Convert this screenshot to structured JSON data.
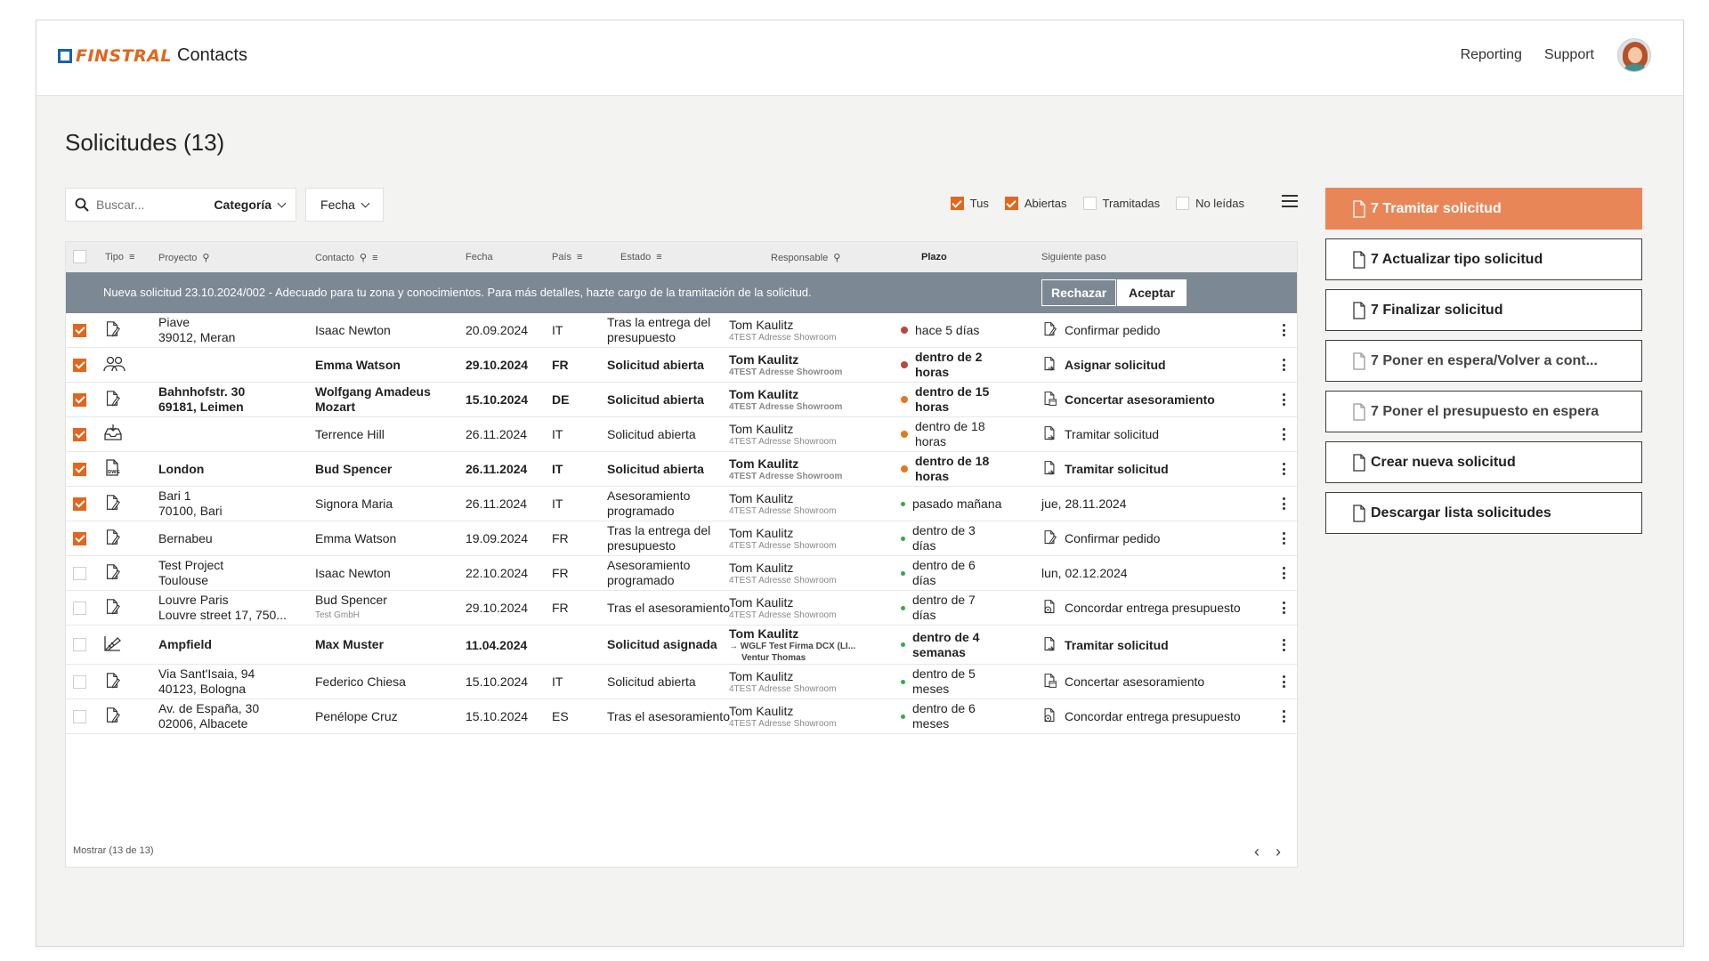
{
  "header": {
    "brand": "FINSTRAL",
    "app": "Contacts",
    "nav": [
      "Reporting",
      "Support"
    ]
  },
  "page": {
    "title": "Solicitudes (13)"
  },
  "toolbar": {
    "search_placeholder": "Buscar...",
    "category_label": "Categoría",
    "date_label": "Fecha",
    "filters": [
      {
        "label": "Tus",
        "checked": true
      },
      {
        "label": "Abiertas",
        "checked": true
      },
      {
        "label": "Tramitadas",
        "checked": false
      },
      {
        "label": "No leídas",
        "checked": false
      }
    ]
  },
  "table": {
    "columns": [
      "Tipo",
      "Proyecto",
      "Contacto",
      "Fecha",
      "País",
      "Estado",
      "Responsable",
      "Plazo",
      "Siguiente paso"
    ],
    "banner": {
      "text": "Nueva solicitud 23.10.2024/002 - Adecuado para tu zona y conocimientos. Para más detalles, hazte cargo de la tramitación de la solicitud.",
      "reject": "Rechazar",
      "accept": "Aceptar"
    },
    "rows": [
      {
        "checked": true,
        "icon": "document-pencil-icon",
        "bold": false,
        "project": [
          "Piave",
          "39012, Meran"
        ],
        "contact": [
          "Isaac Newton"
        ],
        "date": "20.09.2024",
        "country": "IT",
        "status": [
          "Tras la entrega del",
          "presupuesto"
        ],
        "resp": "Tom Kaulitz",
        "resp_sub": "4TEST Adresse Showroom",
        "deadline": [
          "hace 5 días"
        ],
        "dot": "#b8493c",
        "dot_small": false,
        "next": "Confirmar pedido",
        "next_icon": "document-pencil-icon"
      },
      {
        "checked": true,
        "icon": "people-icon",
        "bold": true,
        "project": [],
        "contact": [
          "Emma Watson"
        ],
        "date": "29.10.2024",
        "country": "FR",
        "status": [
          "Solicitud abierta"
        ],
        "resp": "Tom Kaulitz",
        "resp_sub": "4TEST Adresse Showroom",
        "deadline": [
          "dentro de 2",
          "horas"
        ],
        "dot": "#b8493c",
        "dot_small": false,
        "next": "Asignar solicitud",
        "next_icon": "document-arrow-icon"
      },
      {
        "checked": true,
        "icon": "document-pencil-icon",
        "bold": true,
        "project": [
          "Bahnhofstr. 30",
          "69181, Leimen"
        ],
        "contact": [
          "Wolfgang Amadeus",
          "Mozart"
        ],
        "date": "15.10.2024",
        "country": "DE",
        "status": [
          "Solicitud abierta"
        ],
        "resp": "Tom Kaulitz",
        "resp_sub": "4TEST Adresse Showroom",
        "deadline": [
          "dentro de 15",
          "horas"
        ],
        "dot": "#e07a1f",
        "dot_small": false,
        "next": "Concertar asesoramiento",
        "next_icon": "document-calendar-icon"
      },
      {
        "checked": true,
        "icon": "inbox-icon",
        "bold": false,
        "project": [],
        "contact": [
          "Terrence Hill"
        ],
        "date": "26.11.2024",
        "country": "IT",
        "status": [
          "Solicitud abierta"
        ],
        "resp": "Tom Kaulitz",
        "resp_sub": "4TEST Adresse Showroom",
        "deadline": [
          "dentro de 18",
          "horas"
        ],
        "dot": "#e07a1f",
        "dot_small": false,
        "next": "Tramitar solicitud",
        "next_icon": "document-arrow-icon"
      },
      {
        "checked": true,
        "icon": "dwg-file-icon",
        "bold": true,
        "project": [
          "London"
        ],
        "contact": [
          "Bud Spencer"
        ],
        "date": "26.11.2024",
        "country": "IT",
        "status": [
          "Solicitud abierta"
        ],
        "resp": "Tom Kaulitz",
        "resp_sub": "4TEST Adresse Showroom",
        "deadline": [
          "dentro de 18",
          "horas"
        ],
        "dot": "#e07a1f",
        "dot_small": false,
        "next": "Tramitar solicitud",
        "next_icon": "document-arrow-icon"
      },
      {
        "checked": true,
        "icon": "document-pencil-icon",
        "bold": false,
        "project": [
          "Bari 1",
          "70100, Bari"
        ],
        "contact": [
          "Signora Maria"
        ],
        "date": "26.11.2024",
        "country": "IT",
        "status": [
          "Asesoramiento",
          "programado"
        ],
        "resp": "Tom Kaulitz",
        "resp_sub": "4TEST Adresse Showroom",
        "deadline": [
          "pasado mañana"
        ],
        "dot": "#3aa64c",
        "dot_small": true,
        "next": "jue, 28.11.2024",
        "next_icon": ""
      },
      {
        "checked": true,
        "icon": "document-pencil-icon",
        "bold": false,
        "project": [
          "Bernabeu"
        ],
        "contact": [
          "Emma Watson"
        ],
        "date": "19.09.2024",
        "country": "FR",
        "status": [
          "Tras la entrega del",
          "presupuesto"
        ],
        "resp": "Tom Kaulitz",
        "resp_sub": "4TEST Adresse Showroom",
        "deadline": [
          "dentro de 3",
          "días"
        ],
        "dot": "#3aa64c",
        "dot_small": true,
        "next": "Confirmar pedido",
        "next_icon": "document-pencil-icon"
      },
      {
        "checked": false,
        "icon": "document-pencil-icon",
        "bold": false,
        "project": [
          "Test Project",
          "Toulouse"
        ],
        "contact": [
          "Isaac Newton"
        ],
        "date": "22.10.2024",
        "country": "FR",
        "status": [
          "Asesoramiento",
          "programado"
        ],
        "resp": "Tom Kaulitz",
        "resp_sub": "4TEST Adresse Showroom",
        "deadline": [
          "dentro de 6",
          "días"
        ],
        "dot": "#3aa64c",
        "dot_small": true,
        "next": "lun, 02.12.2024",
        "next_icon": ""
      },
      {
        "checked": false,
        "icon": "document-pencil-icon",
        "bold": false,
        "project": [
          "Louvre Paris",
          "Louvre street 17, 750..."
        ],
        "contact": [
          "Bud Spencer",
          "Test GmbH"
        ],
        "date": "29.10.2024",
        "country": "FR",
        "status": [
          "Tras el asesoramiento"
        ],
        "resp": "Tom Kaulitz",
        "resp_sub": "4TEST Adresse Showroom",
        "deadline": [
          "dentro de 7",
          "días"
        ],
        "dot": "#3aa64c",
        "dot_small": true,
        "next": "Concordar entrega presupuesto",
        "next_icon": "gear-document-icon"
      },
      {
        "checked": false,
        "icon": "blueprint-icon",
        "bold": true,
        "project": [
          "Ampfield"
        ],
        "contact": [
          "Max Muster"
        ],
        "date": "11.04.2024",
        "country": "",
        "status": [
          "Solicitud asignada"
        ],
        "resp": "Tom Kaulitz",
        "resp_sub": "→ WGLF Test Firma DCX (LI...",
        "resp_sub2": "Ventur Thomas",
        "deadline": [
          "dentro de 4",
          "semanas"
        ],
        "dot": "#3aa64c",
        "dot_small": true,
        "next": "Tramitar solicitud",
        "next_icon": "document-arrow-icon"
      },
      {
        "checked": false,
        "icon": "document-pencil-icon",
        "bold": false,
        "project": [
          "Via Sant'Isaia, 94",
          "40123, Bologna"
        ],
        "contact": [
          "Federico Chiesa"
        ],
        "date": "15.10.2024",
        "country": "IT",
        "status": [
          "Solicitud abierta"
        ],
        "resp": "Tom Kaulitz",
        "resp_sub": "4TEST Adresse Showroom",
        "deadline": [
          "dentro de 5",
          "meses"
        ],
        "dot": "#3aa64c",
        "dot_small": true,
        "next": "Concertar asesoramiento",
        "next_icon": "document-calendar-icon"
      },
      {
        "checked": false,
        "icon": "document-pencil-icon",
        "bold": false,
        "project": [
          "Av. de España, 30",
          "02006, Albacete"
        ],
        "contact": [
          "Penélope Cruz"
        ],
        "date": "15.10.2024",
        "country": "ES",
        "status": [
          "Tras el asesoramiento"
        ],
        "resp": "Tom Kaulitz",
        "resp_sub": "4TEST Adresse Showroom",
        "deadline": [
          "dentro de 6",
          "meses"
        ],
        "dot": "#3aa64c",
        "dot_small": true,
        "next": "Concordar entrega presupuesto",
        "next_icon": "gear-document-icon"
      }
    ],
    "footer": {
      "shown": "Mostrar  (13 de 13)",
      "prev": "‹",
      "next": "›"
    }
  },
  "actions": [
    {
      "label": "7 Tramitar solicitud",
      "style": "primary"
    },
    {
      "label": "7 Actualizar tipo solicitud",
      "style": "normal"
    },
    {
      "label": "7 Finalizar solicitud",
      "style": "normal"
    },
    {
      "label": "7 Poner en espera/Volver a cont...",
      "style": "disabled"
    },
    {
      "label": "7 Poner el presupuesto en espera",
      "style": "disabled"
    },
    {
      "label": "Crear nueva solicitud",
      "style": "normal"
    },
    {
      "label": "Descargar lista solicitudes",
      "style": "normal"
    }
  ],
  "colors": {
    "accent": "#e2661d",
    "primary_button": "#e98658",
    "banner": "#7d8895",
    "brand_blue": "#1463a8"
  }
}
